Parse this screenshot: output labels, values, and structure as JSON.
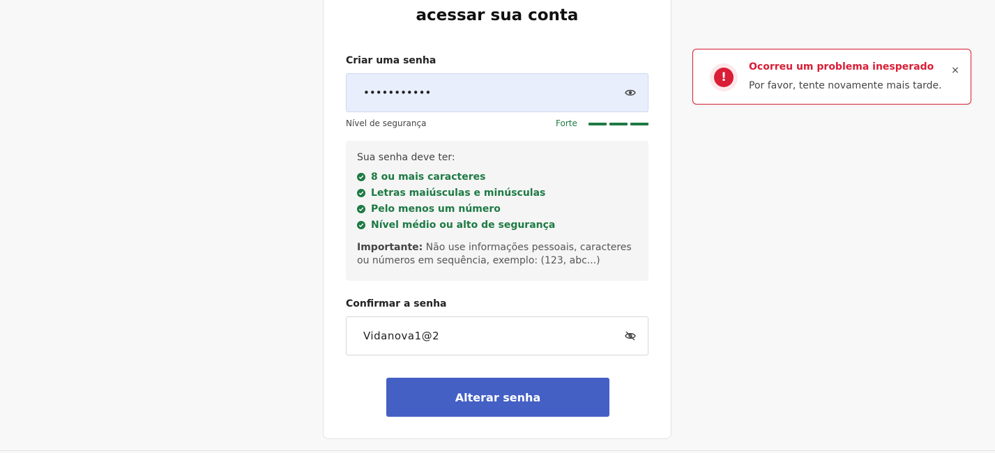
{
  "heading": {
    "line_cut": "acessar",
    "title": "acessar sua conta"
  },
  "password": {
    "label": "Criar uma senha",
    "value": "•••••••••••",
    "toggle_icon": "eye-icon"
  },
  "strength": {
    "label": "Nível de segurança",
    "value": "Forte",
    "level": 3,
    "max_level": 3,
    "color": "#1d7a43"
  },
  "rules": {
    "title": "Sua senha deve ter:",
    "items": [
      "8 ou mais caracteres",
      "Letras maiúsculas e minúsculas",
      "Pelo menos um número",
      "Nível médio ou alto de segurança"
    ],
    "important_label": "Importante:",
    "important_text": " Não use informações pessoais, caracteres ou números em sequência, exemplo: (123, abc...)"
  },
  "confirm": {
    "label": "Confirmar a senha",
    "value": "Vidanova1@2",
    "toggle_icon": "eye-off-icon"
  },
  "submit": {
    "label": "Alterar senha",
    "color": "#4460c4"
  },
  "toast": {
    "title": "Ocorreu um problema inesperado",
    "message": "Por favor, tente novamente mais tarde.",
    "icon": "!",
    "close": "×",
    "color": "#d91e36"
  }
}
